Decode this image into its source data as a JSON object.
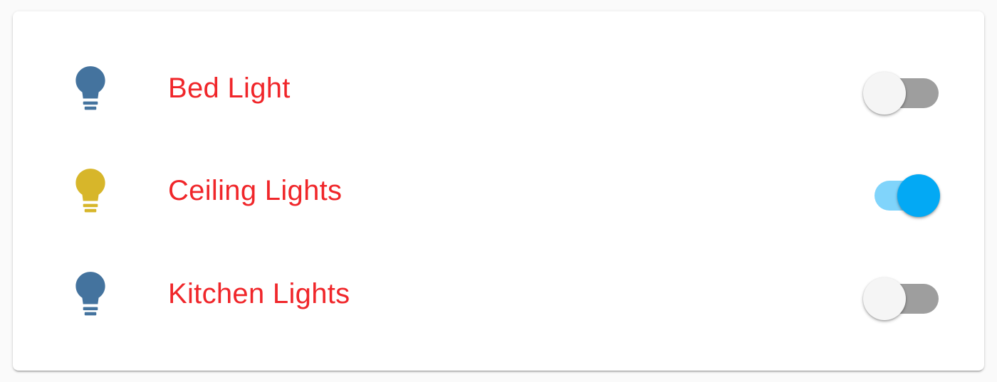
{
  "entities": [
    {
      "name": "Bed Light",
      "state": "off",
      "icon": "lightbulb-icon",
      "icon_color": "#44739e"
    },
    {
      "name": "Ceiling Lights",
      "state": "on",
      "icon": "lightbulb-icon",
      "icon_color": "#d7b62a"
    },
    {
      "name": "Kitchen Lights",
      "state": "off",
      "icon": "lightbulb-icon",
      "icon_color": "#44739e"
    }
  ],
  "colors": {
    "label": "#f0262a",
    "toggle_on_track": "#80d4fb",
    "toggle_on_thumb": "#03a9f4",
    "toggle_off_track": "#9e9e9e",
    "toggle_off_thumb": "#f5f5f5"
  }
}
